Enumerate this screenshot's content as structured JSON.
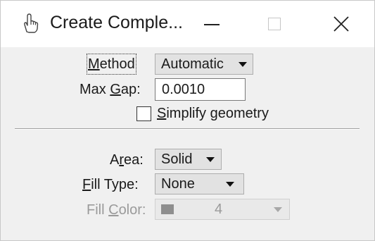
{
  "window": {
    "title": "Create Comple...",
    "icon": "hand-pointer-icon",
    "controls": {
      "minimize": "minimize-icon",
      "maximize": "maximize-icon",
      "close": "close-icon"
    }
  },
  "section1": {
    "method": {
      "label_mnemonic": "M",
      "label_rest": "ethod",
      "value": "Automatic"
    },
    "max_gap": {
      "label_pre": "Max ",
      "label_mnemonic": "G",
      "label_rest": "ap:",
      "value": "0.0010"
    },
    "simplify": {
      "label_mnemonic": "S",
      "label_rest": "implify geometry",
      "checked": false
    }
  },
  "section2": {
    "area": {
      "label_pre": "A",
      "label_mnemonic": "r",
      "label_rest": "ea:",
      "value": "Solid"
    },
    "fill_type": {
      "label_mnemonic": "F",
      "label_rest": "ill Type:",
      "value": "None"
    },
    "fill_color": {
      "label_pre": "Fill ",
      "label_mnemonic": "C",
      "label_rest": "olor:",
      "value": "4",
      "swatch_color": "#8e8e8e",
      "enabled": false
    }
  }
}
